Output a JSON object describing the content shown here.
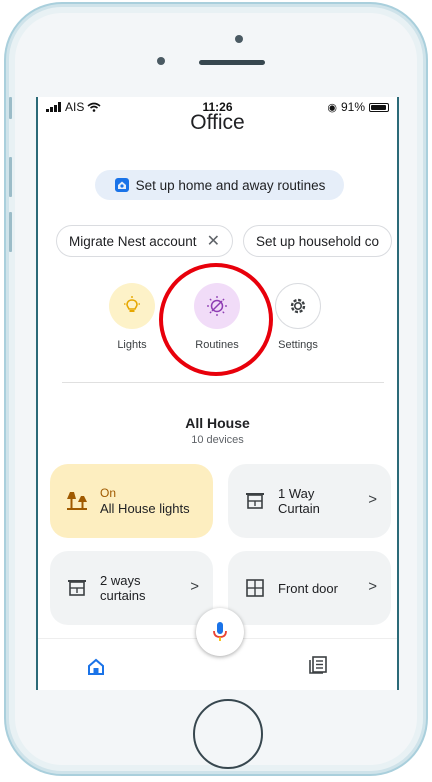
{
  "status_bar": {
    "carrier": "AIS",
    "time": "11:26",
    "battery": "91%"
  },
  "header": {
    "title": "Office"
  },
  "banner": {
    "label": "Set up home and away routines"
  },
  "suggestion_chips": [
    {
      "label": "Migrate Nest account",
      "dismiss": "✕"
    },
    {
      "label": "Set up household co"
    }
  ],
  "quick_actions": {
    "lights": {
      "label": "Lights",
      "icon": "lightbulb-icon"
    },
    "routines": {
      "label": "Routines",
      "icon": "routines-icon"
    },
    "settings": {
      "label": "Settings",
      "icon": "gear-icon"
    }
  },
  "section": {
    "title": "All House",
    "subtitle": "10 devices"
  },
  "devices": [
    {
      "state": "On",
      "name": "All House lights",
      "icon": "lamp-icon"
    },
    {
      "name_line1": "1 Way",
      "name_line2": "Curtain",
      "icon": "curtain-icon"
    },
    {
      "name_line1": "2 ways",
      "name_line2": "curtains",
      "icon": "curtain-icon"
    },
    {
      "name": "Front door",
      "icon": "door-icon"
    }
  ],
  "chevron": ">",
  "colors": {
    "accent_blue": "#1a73e8",
    "highlight_red": "#e8000b",
    "lights_bg": "#fdf2c8",
    "routines_bg": "#f1dcf8"
  }
}
